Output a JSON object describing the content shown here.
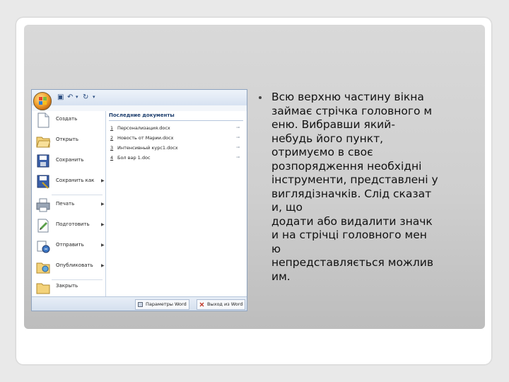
{
  "screenshot": {
    "office_menu": {
      "left_items": [
        {
          "label": "Создать",
          "icon": "new-document-icon",
          "submenu": false
        },
        {
          "label": "Открыть",
          "icon": "open-folder-icon",
          "submenu": false
        },
        {
          "label": "Сохранить",
          "icon": "save-icon",
          "submenu": false
        },
        {
          "label": "Сохранить как",
          "icon": "save-as-icon",
          "submenu": true
        },
        {
          "label": "Печать",
          "icon": "printer-icon",
          "submenu": true
        },
        {
          "label": "Подготовить",
          "icon": "prepare-icon",
          "submenu": true
        },
        {
          "label": "Отправить",
          "icon": "send-icon",
          "submenu": true
        },
        {
          "label": "Опубликовать",
          "icon": "publish-icon",
          "submenu": true
        },
        {
          "label": "Закрыть",
          "icon": "close-folder-icon",
          "submenu": false
        }
      ],
      "recent_title": "Последние документы",
      "recent_docs": [
        {
          "num": "1",
          "name": "Персонализация.docx"
        },
        {
          "num": "2",
          "name": "Новость от Марии.docx"
        },
        {
          "num": "3",
          "name": "Интенсивный курс1.docx"
        },
        {
          "num": "4",
          "name": "Бол вар 1.doc"
        }
      ],
      "options_button": "Параметры Word",
      "exit_button": "Выход из Word"
    }
  },
  "text": {
    "lines": [
      "Всю верхню частину вікна",
      "займає стрічка головного м",
      "еню. Вибравши який-",
      "небудь його пункт,",
      "отримуємо в своє",
      "розпорядження необхідні",
      "інструменти, представлені у",
      "виглядізначків. Слід сказат",
      "и, що",
      "додати або видалити значк",
      "и на стрічці головного мен",
      "ю",
      "непредставляється можлив",
      "им."
    ]
  }
}
